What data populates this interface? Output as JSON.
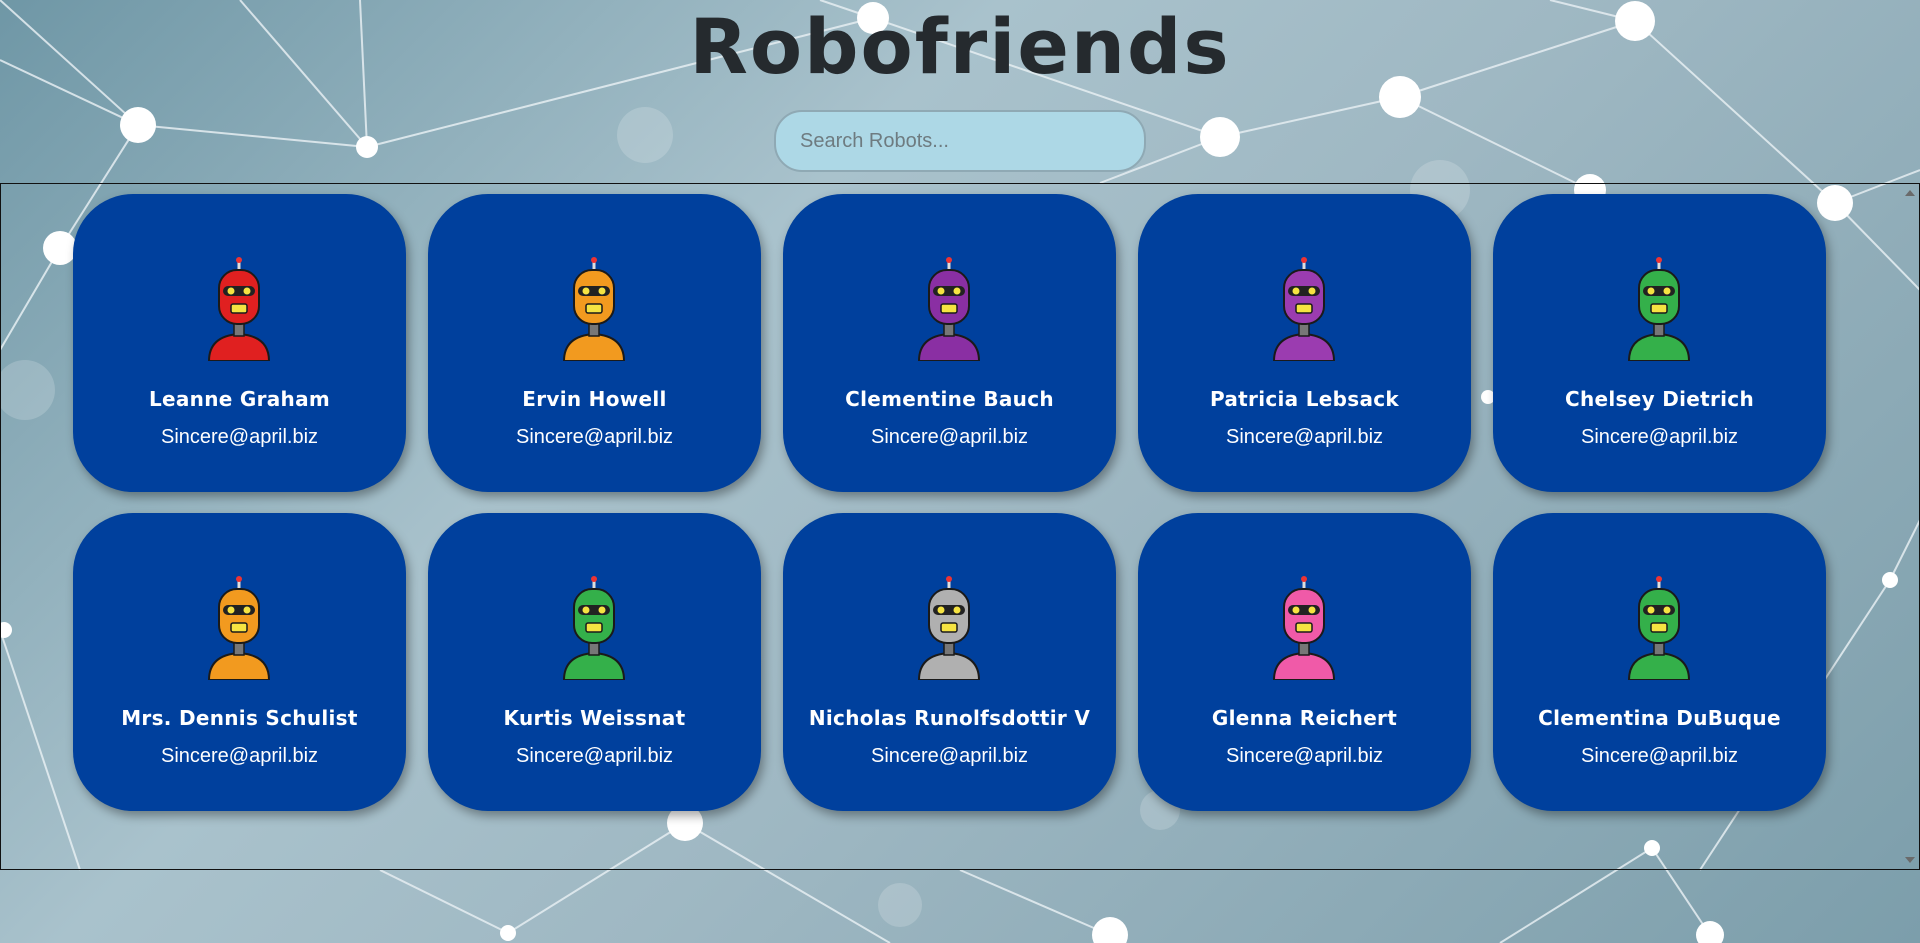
{
  "app": {
    "title": "Robofriends"
  },
  "search": {
    "placeholder": "Search Robots..."
  },
  "colors": {
    "card_background": "#00409d",
    "search_background": "#add8e6",
    "title_color": "#252a2e"
  },
  "robots": [
    {
      "name": "Leanne Graham",
      "email": "Sincere@april.biz",
      "color": "#e02020",
      "icon": "red-robot-icon"
    },
    {
      "name": "Ervin Howell",
      "email": "Sincere@april.biz",
      "color": "#f29a1f",
      "icon": "orange-robot-icon"
    },
    {
      "name": "Clementine Bauch",
      "email": "Sincere@april.biz",
      "color": "#8a2fa3",
      "icon": "purple-robot-icon"
    },
    {
      "name": "Patricia Lebsack",
      "email": "Sincere@april.biz",
      "color": "#9b3cb0",
      "icon": "purple-robot-icon"
    },
    {
      "name": "Chelsey Dietrich",
      "email": "Sincere@april.biz",
      "color": "#34b04a",
      "icon": "green-robot-icon"
    },
    {
      "name": "Mrs. Dennis Schulist",
      "email": "Sincere@april.biz",
      "color": "#f29a1f",
      "icon": "orange-robot-icon"
    },
    {
      "name": "Kurtis Weissnat",
      "email": "Sincere@april.biz",
      "color": "#34b04a",
      "icon": "green-robot-icon"
    },
    {
      "name": "Nicholas Runolfsdottir V",
      "email": "Sincere@april.biz",
      "color": "#b0b0b0",
      "icon": "gray-robot-icon"
    },
    {
      "name": "Glenna Reichert",
      "email": "Sincere@april.biz",
      "color": "#f05aa8",
      "icon": "pink-robot-icon"
    },
    {
      "name": "Clementina DuBuque",
      "email": "Sincere@april.biz",
      "color": "#34b04a",
      "icon": "green-robot-icon"
    }
  ]
}
